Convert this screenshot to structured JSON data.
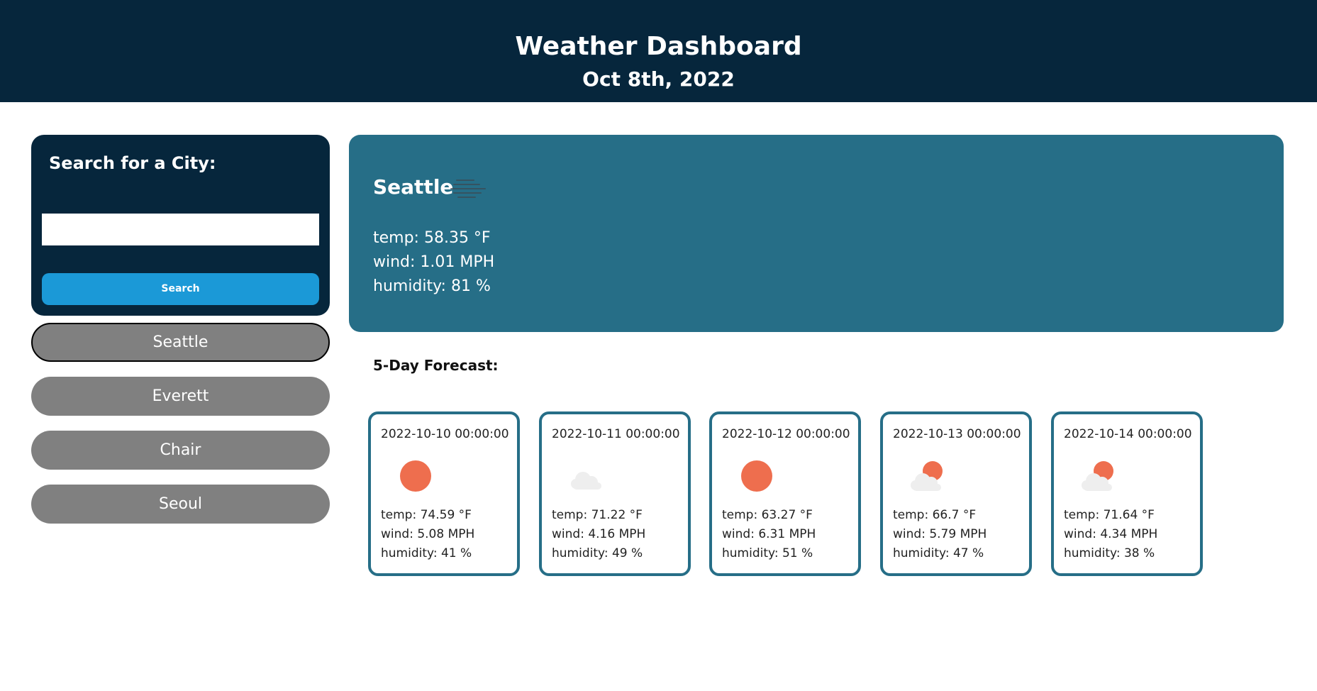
{
  "header": {
    "title": "Weather Dashboard",
    "date": "Oct 8th, 2022"
  },
  "search": {
    "heading": "Search for a City:",
    "input_value": "",
    "button_label": "Search"
  },
  "history": [
    {
      "label": "Seattle",
      "active": true
    },
    {
      "label": "Everett",
      "active": false
    },
    {
      "label": "Chair",
      "active": false
    },
    {
      "label": "Seoul",
      "active": false
    }
  ],
  "current": {
    "city": "Seattle",
    "icon": "mist-icon",
    "temp": "temp: 58.35 °F",
    "wind": "wind: 1.01 MPH",
    "humidity": "humidity: 81 %"
  },
  "forecast": {
    "title": "5-Day Forecast:",
    "days": [
      {
        "date": "2022-10-10 00:00:00",
        "icon": "sun-icon",
        "temp": "temp: 74.59 °F",
        "wind": "wind: 5.08 MPH",
        "humidity": "humidity: 41 %"
      },
      {
        "date": "2022-10-11 00:00:00",
        "icon": "cloud-icon",
        "temp": "temp: 71.22 °F",
        "wind": "wind: 4.16 MPH",
        "humidity": "humidity: 49 %"
      },
      {
        "date": "2022-10-12 00:00:00",
        "icon": "sun-icon",
        "temp": "temp: 63.27 °F",
        "wind": "wind: 6.31 MPH",
        "humidity": "humidity: 51 %"
      },
      {
        "date": "2022-10-13 00:00:00",
        "icon": "partly-cloudy-icon",
        "temp": "temp: 66.7 °F",
        "wind": "wind: 5.79 MPH",
        "humidity": "humidity: 47 %"
      },
      {
        "date": "2022-10-14 00:00:00",
        "icon": "partly-cloudy-icon",
        "temp": "temp: 71.64 °F",
        "wind": "wind: 4.34 MPH",
        "humidity": "humidity: 38 %"
      }
    ]
  },
  "colors": {
    "header_bg": "#06263c",
    "panel_bg": "#06263c",
    "accent": "#1b99d7",
    "current_bg": "#266e87",
    "history_btn": "#808080",
    "sun": "#ee6e4e",
    "cloud": "#eeeeee"
  }
}
